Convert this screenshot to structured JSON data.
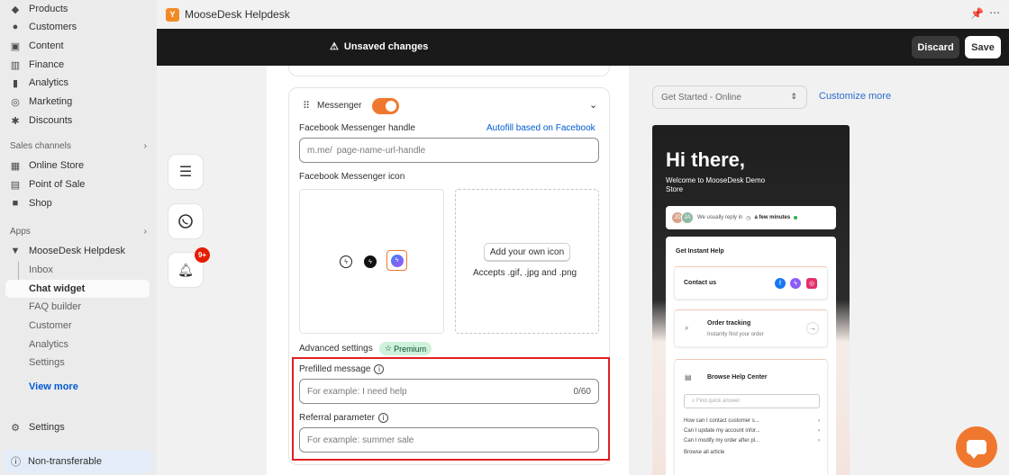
{
  "header": {
    "app_title": "MooseDesk Helpdesk",
    "app_logo_letter": "Y"
  },
  "save_bar": {
    "message": "Unsaved changes",
    "discard_label": "Discard",
    "save_label": "Save"
  },
  "sidebar": {
    "items": [
      {
        "label": "Products",
        "icon": "tag-icon"
      },
      {
        "label": "Customers",
        "icon": "person-icon"
      },
      {
        "label": "Content",
        "icon": "content-icon"
      },
      {
        "label": "Finance",
        "icon": "bank-icon"
      },
      {
        "label": "Analytics",
        "icon": "bar-chart-icon"
      },
      {
        "label": "Marketing",
        "icon": "target-icon"
      },
      {
        "label": "Discounts",
        "icon": "discount-icon"
      }
    ],
    "sales_channels_title": "Sales channels",
    "sales_channels": [
      {
        "label": "Online Store",
        "icon": "store-icon"
      },
      {
        "label": "Point of Sale",
        "icon": "pos-icon"
      },
      {
        "label": "Shop",
        "icon": "shop-icon"
      }
    ],
    "apps_title": "Apps",
    "app_name": "MooseDesk Helpdesk",
    "app_sub_items": [
      "Inbox",
      "Chat widget",
      "FAQ builder",
      "Customer",
      "Analytics",
      "Settings"
    ],
    "view_more": "View more",
    "settings": "Settings",
    "non_transferable": "Non-transferable"
  },
  "floating": {
    "notification_badge": "9+"
  },
  "messenger_card": {
    "title": "Messenger",
    "toggle_on": true,
    "handle_label": "Facebook Messenger handle",
    "autofill_link": "Autofill based on Facebook",
    "handle_prefix": "m.me/",
    "handle_placeholder": "page-name-url-handle",
    "icon_label": "Facebook Messenger icon",
    "add_icon_button": "Add your own icon",
    "accepts_text": "Accepts .gif, .jpg and .png",
    "advanced_label": "Advanced settings",
    "premium_badge": "Premium",
    "prefilled_label": "Prefilled message",
    "prefilled_placeholder": "For example: I need help",
    "prefilled_counter": "0/60",
    "referral_label": "Referral parameter",
    "referral_placeholder": "For example: summer sale"
  },
  "preview": {
    "select_value": "Get Started - Online",
    "customize_link": "Customize more",
    "widget": {
      "greeting": "Hi there,",
      "welcome": "Welcome to MooseDesk Demo Store",
      "reply_prefix": "We usually reply in",
      "reply_time": "a few minutes",
      "avatar_1": "JD",
      "avatar_2": "JA",
      "instant_help": "Get Instant Help",
      "contact_us": "Contact us",
      "order_tracking": "Order tracking",
      "order_tracking_sub": "Instantly find your order",
      "browse_help": "Browse Help Center",
      "search_placeholder": "Find quick answer",
      "faqs": [
        "How can I contact customer s...",
        "Can I update my account infor...",
        "Can I modify my order after pl..."
      ],
      "browse_all": "Browse all article"
    }
  },
  "colors": {
    "accent_orange": "#f0782e",
    "highlight_red": "#e02020",
    "link_blue": "#005bd3"
  }
}
